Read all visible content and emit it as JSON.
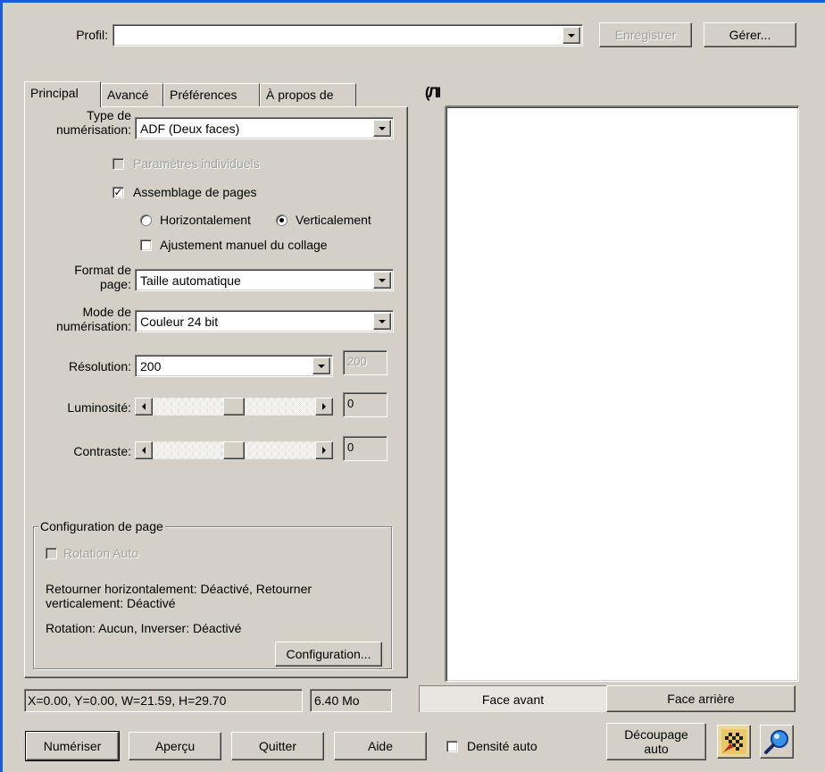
{
  "profile": {
    "label": "Profil:",
    "value": "",
    "save_label": "Enregistrer",
    "manage_label": "Gérer..."
  },
  "tabs": [
    {
      "label": "Principal",
      "active": true
    },
    {
      "label": "Avancé",
      "active": false
    },
    {
      "label": "Préférences",
      "active": false
    },
    {
      "label": "À propos de",
      "active": false
    }
  ],
  "principal": {
    "scan_type": {
      "label_line1": "Type de",
      "label_line2": "numérisation:",
      "value": "ADF (Deux faces)"
    },
    "individual_params": {
      "label": "Paramètres individuels",
      "checked": false,
      "enabled": false
    },
    "page_merge": {
      "label": "Assemblage de pages",
      "checked": true
    },
    "horizontal": {
      "label": "Horizontalement",
      "selected": false
    },
    "vertical": {
      "label": "Verticalement",
      "selected": true
    },
    "manual_merge": {
      "label": "Ajustement manuel du collage",
      "checked": false
    },
    "page_format": {
      "label_line1": "Format de",
      "label_line2": "page:",
      "value": "Taille automatique"
    },
    "scan_mode": {
      "label_line1": "Mode de",
      "label_line2": "numérisation:",
      "value": "Couleur 24 bit"
    },
    "resolution": {
      "label": "Résolution:",
      "value": "200",
      "custom_value": "200"
    },
    "brightness": {
      "label": "Luminosité:",
      "value": "0",
      "level": 0.5
    },
    "contrast": {
      "label": "Contraste:",
      "value": "0",
      "level": 0.5
    }
  },
  "page_config": {
    "title": "Configuration de page",
    "auto_rotation": {
      "label": "Rotation Auto",
      "checked": false,
      "enabled": false
    },
    "flip_text": "Retourner horizontalement: Déactivé, Retourner verticalement: Déactivé",
    "rotation_text": "Rotation: Aucun, Inverser: Déactivé",
    "config_button": "Configuration..."
  },
  "status": {
    "coords": "X=0.00, Y=0.00, W=21.59, H=29.70",
    "size": "6.40 Mo"
  },
  "preview": {
    "front_tab": "Face avant",
    "back_tab": "Face arrière",
    "ruler_icon": "ruler-toggle-icon"
  },
  "bottom": {
    "scan_button": "Numériser",
    "preview_button": "Aperçu",
    "quit_button": "Quitter",
    "help_button": "Aide",
    "auto_density": {
      "label": "Densité auto",
      "checked": false
    },
    "auto_crop_line1": "Découpage",
    "auto_crop_line2": "auto",
    "icons": [
      "checkerboard-icon",
      "zoom-magnifier-icon"
    ]
  },
  "colors": {
    "face": "#d4d0c8",
    "accent": "#1c5ad6"
  }
}
